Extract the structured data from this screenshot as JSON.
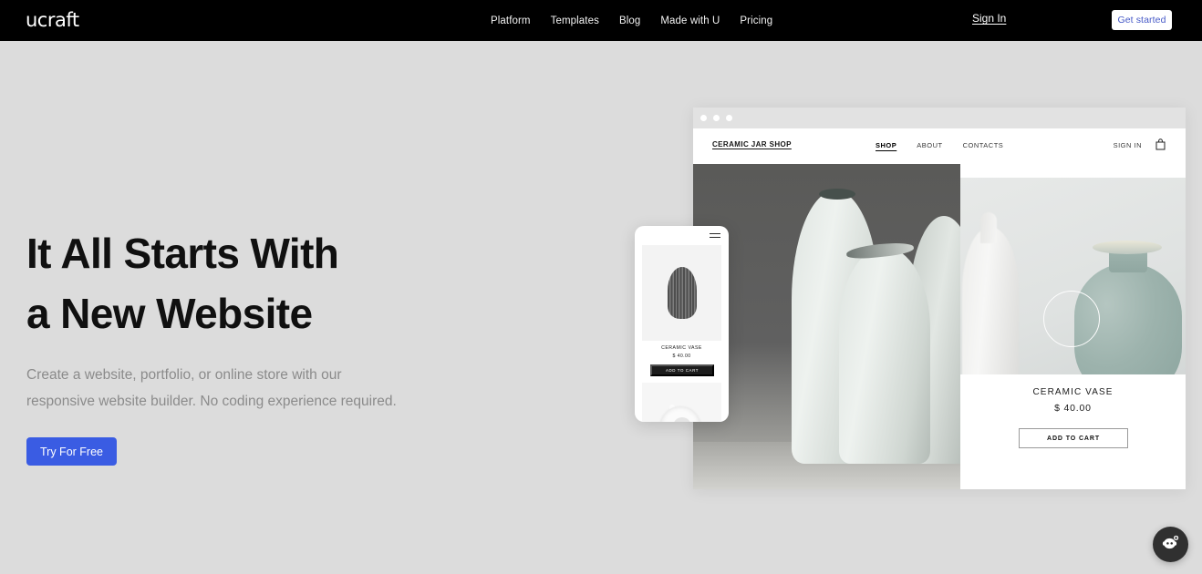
{
  "brand": {
    "logo_text": "ucraft"
  },
  "topnav": {
    "links": [
      {
        "label": "Platform"
      },
      {
        "label": "Templates"
      },
      {
        "label": "Blog"
      },
      {
        "label": "Made with U"
      },
      {
        "label": "Pricing"
      }
    ],
    "sign_in_label": "Sign In",
    "get_started_label": "Get started",
    "background_color": "#000000",
    "get_started_text_color": "#4659c7"
  },
  "hero": {
    "headline_line1": "It All Starts With",
    "headline_line2": "a New Website",
    "subtitle": "Create a website, portfolio, or online store with our responsive website builder. No coding experience required.",
    "cta_label": "Try For Free",
    "cta_color": "#3a5ce3",
    "background_color": "#dcdcdc"
  },
  "mockup_browser": {
    "window_dots": 3,
    "site": {
      "brand": "CERAMIC JAR SHOP",
      "nav": [
        {
          "label": "SHOP",
          "active": true
        },
        {
          "label": "ABOUT",
          "active": false
        },
        {
          "label": "CONTACTS",
          "active": false
        }
      ],
      "sign_in_label": "SIGN IN",
      "cart_icon": "shopping-bag-icon",
      "product": {
        "title": "CERAMIC VASE",
        "price": "$ 40.00",
        "add_to_cart_label": "ADD TO CART"
      }
    }
  },
  "mockup_phone": {
    "menu_icon": "hamburger-menu-icon",
    "product": {
      "title": "CERAMIC VASE",
      "price": "$ 40.00",
      "add_to_cart_label": "ADD TO CART"
    }
  },
  "chat_widget": {
    "icon": "chat-bot-icon",
    "color": "#303030"
  }
}
